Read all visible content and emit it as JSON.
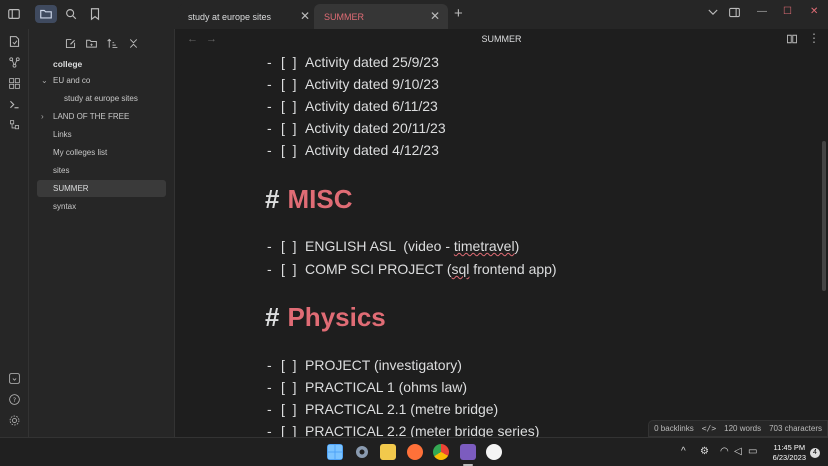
{
  "tabs": [
    {
      "label": "study at europe sites"
    },
    {
      "label": "SUMMER"
    }
  ],
  "sidebar": {
    "vault_name": "college",
    "items": [
      {
        "label": "EU and co",
        "expanded": true
      },
      {
        "label": "study at europe sites"
      },
      {
        "label": "LAND OF THE FREE",
        "expanded": false
      },
      {
        "label": "Links"
      },
      {
        "label": "My colleges list"
      },
      {
        "label": "sites"
      },
      {
        "label": "SUMMER",
        "selected": true
      },
      {
        "label": "syntax"
      }
    ]
  },
  "view": {
    "title": "SUMMER"
  },
  "document": {
    "tasks_top": [
      {
        "text": "Activity dated 25/9/23"
      },
      {
        "text": "Activity dated 9/10/23"
      },
      {
        "text": "Activity dated 6/11/23"
      },
      {
        "text": "Activity dated 20/11/23"
      },
      {
        "text": "Activity dated 4/12/23"
      }
    ],
    "heading_misc": {
      "hash": "#",
      "text": "MISC"
    },
    "tasks_misc": [
      {
        "text_before": "ENGLISH ASL  (video - ",
        "text_squiggle": "timetravel",
        "text_after": ")"
      },
      {
        "text_before": "COMP SCI PROJECT (",
        "text_squiggle": "sql",
        "text_after": " frontend app)"
      }
    ],
    "heading_physics": {
      "hash": "#",
      "text": "Physics"
    },
    "tasks_physics": [
      {
        "text": "PROJECT (investigatory)"
      },
      {
        "text": "PRACTICAL 1 (ohms law)"
      },
      {
        "text": "PRACTICAL 2.1 (metre bridge)"
      },
      {
        "text": "PRACTICAL 2.2 (meter bridge series)"
      }
    ],
    "dash": "-",
    "checkbox": "[  ]"
  },
  "status": {
    "backlinks": "0 backlinks",
    "words": "120 words",
    "characters": "703 characters"
  },
  "taskbar": {
    "time": "11:45 PM",
    "date": "6/23/2023",
    "notification_count": "4"
  },
  "colors": {
    "accent_red": "#e06c75",
    "bg_main": "#1e1e1e",
    "bg_panel": "#262626"
  }
}
